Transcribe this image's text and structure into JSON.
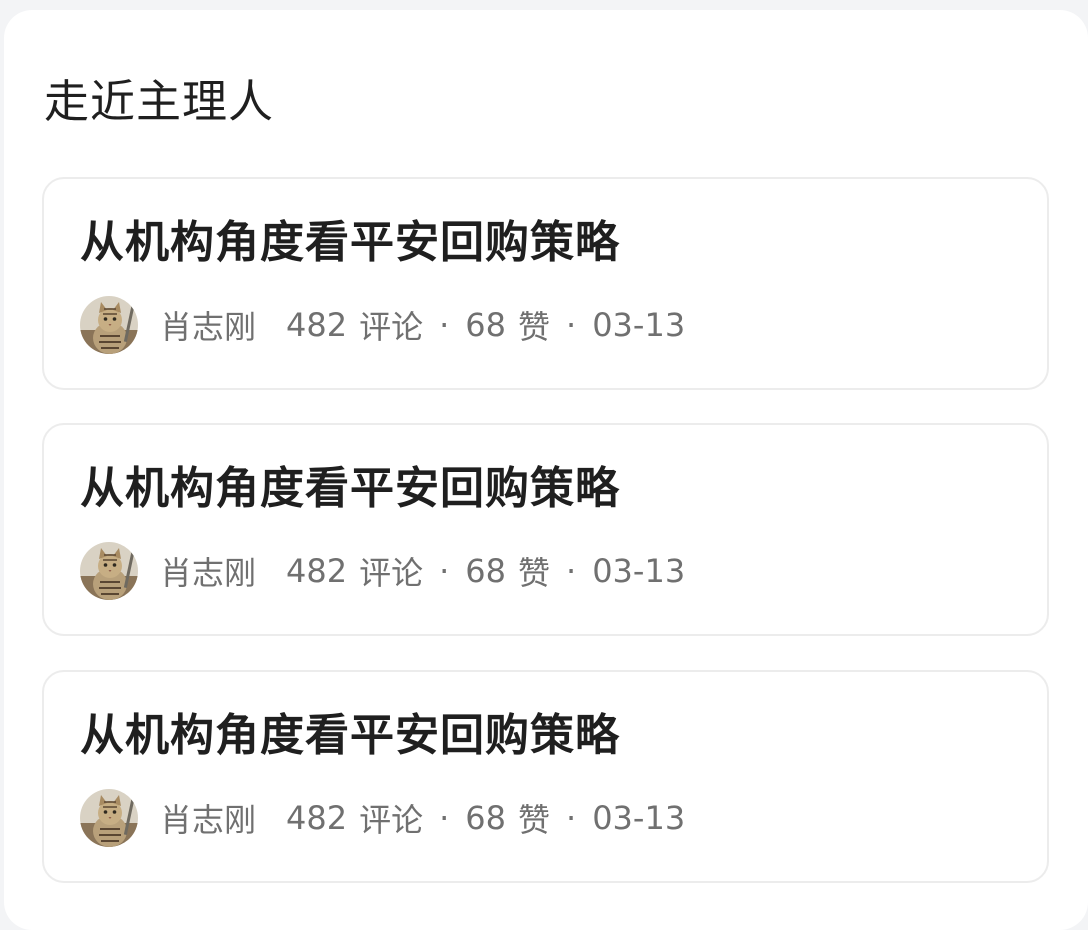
{
  "section": {
    "title": "走近主理人"
  },
  "articles": [
    {
      "title": "从机构角度看平安回购策略",
      "author": "肖志刚",
      "comments_count": "482",
      "comments_label": "评论",
      "likes_count": "68",
      "likes_label": "赞",
      "date": "03-13",
      "separator": "·",
      "avatar_icon": "cat-avatar-icon"
    },
    {
      "title": "从机构角度看平安回购策略",
      "author": "肖志刚",
      "comments_count": "482",
      "comments_label": "评论",
      "likes_count": "68",
      "likes_label": "赞",
      "date": "03-13",
      "separator": "·",
      "avatar_icon": "cat-avatar-icon"
    },
    {
      "title": "从机构角度看平安回购策略",
      "author": "肖志刚",
      "comments_count": "482",
      "comments_label": "评论",
      "likes_count": "68",
      "likes_label": "赞",
      "date": "03-13",
      "separator": "·",
      "avatar_icon": "cat-avatar-icon"
    }
  ],
  "colors": {
    "background": "#f3f4f6",
    "card": "#ffffff",
    "title_text": "#1f1f1f",
    "meta_text": "#707070",
    "card_border": "#ececec"
  }
}
